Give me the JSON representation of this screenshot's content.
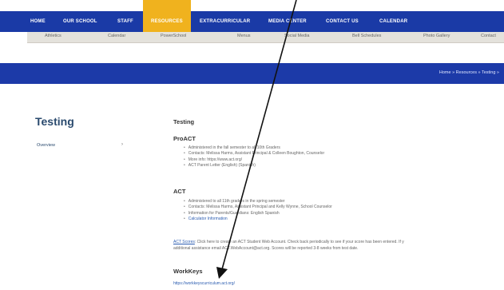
{
  "topnav": {
    "items": [
      "HOME",
      "OUR SCHOOL",
      "STAFF",
      "RESOURCES",
      "EXTRACURRICULAR",
      "MEDIA CENTER",
      "CONTACT US",
      "CALENDAR"
    ],
    "active": "RESOURCES"
  },
  "subnav": {
    "items": [
      "Athletics",
      "Calendar",
      "PowerSchool",
      "Menus",
      "Social Media",
      "Bell Schedules",
      "Photo Gallery",
      "Contact"
    ]
  },
  "breadcrumb": "Home » Resources » Testing »",
  "sidebar": {
    "title": "Testing",
    "items": [
      {
        "label": "Overview",
        "chevron": "›"
      }
    ]
  },
  "content": {
    "heading": "Testing",
    "proact": {
      "heading": "ProACT",
      "items": [
        "Administered in the fall semester to all 10th Graders",
        "Contacts: Melissa Harms, Assistant Principal & Colleen Boughton, Counselor",
        "More info: https://www.act.org/",
        "ACT Parent Letter (English) (Spanish)"
      ]
    },
    "act": {
      "heading": "ACT",
      "items": [
        "Administered to all 11th graders in the spring semester",
        "Contacts: Melissa Harms, Assistant Principal and Kelly Wynne, School Counselor",
        "Information for Parents/Guardians: English Spanish",
        "Calculator Information"
      ]
    },
    "act_scores": {
      "link": "ACT Scores",
      "line1": ": Click here to create an ACT Student Web Account. Check back periodically to see if your score has been entered. If y",
      "line2": "additional assistance email ACT.WebAccount@act.org. Scores will be reported 3-8 weeks from test date."
    },
    "workkeys": {
      "heading": "WorkKeys",
      "link": "https://workkeyscurriculum.act.org/"
    }
  },
  "colors": {
    "nav_blue": "#1a3aa6",
    "active_tab": "#f0b21e",
    "banner_blue": "#1c3aa8",
    "title_blue": "#2a4a6e",
    "link_blue": "#2b5cb0",
    "arrow": "#111111"
  }
}
